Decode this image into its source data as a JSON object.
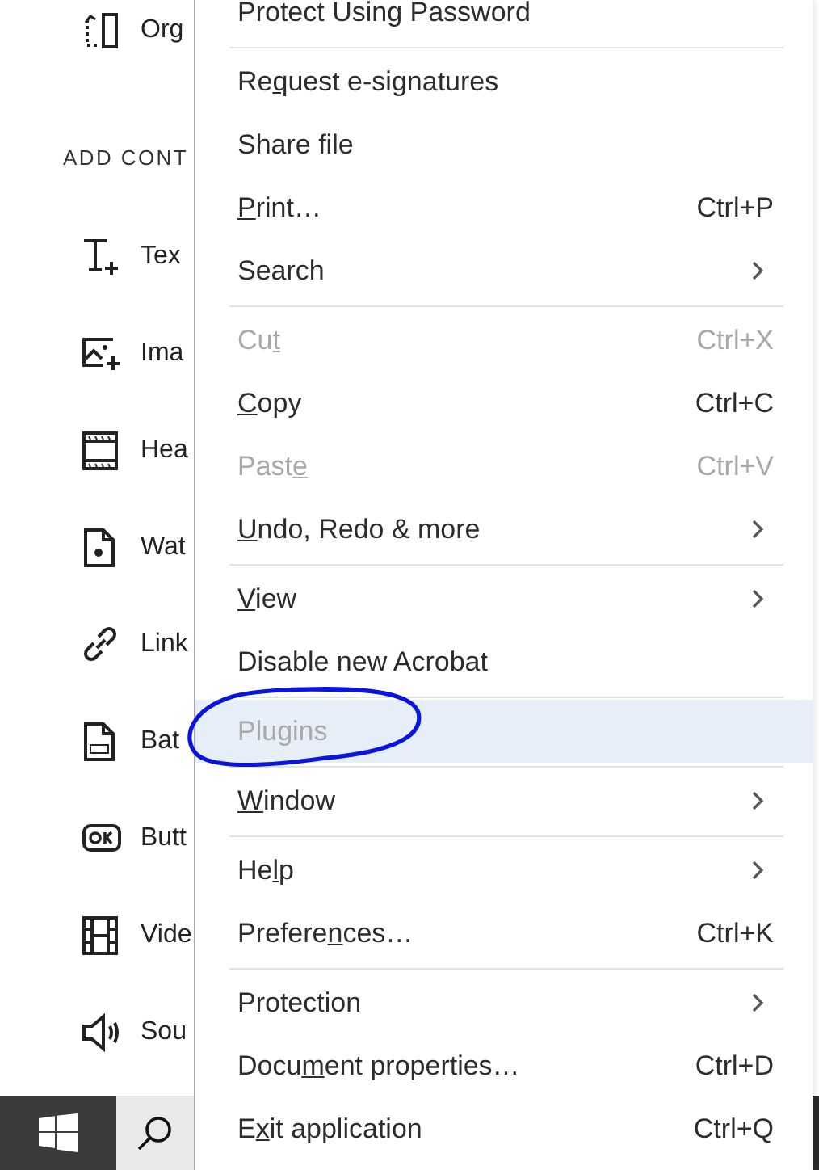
{
  "sidebar": {
    "items_top": [
      {
        "label": "Org"
      }
    ],
    "section_header": "ADD CONT",
    "items": [
      {
        "label": "Tex"
      },
      {
        "label": "Ima"
      },
      {
        "label": "Hea"
      },
      {
        "label": "Wat"
      },
      {
        "label": "Link"
      },
      {
        "label": "Bat"
      },
      {
        "label": "Butt"
      },
      {
        "label": "Vide"
      },
      {
        "label": "Sou"
      }
    ]
  },
  "context_menu": {
    "entries": [
      {
        "kind": "item",
        "label": "Protect Using Password",
        "submenu": false,
        "disabled": false,
        "hovered": false
      },
      {
        "kind": "separator"
      },
      {
        "kind": "item",
        "label_start": "Re",
        "mnemonic": "q",
        "label_end": "uest e-signatures",
        "submenu": false,
        "disabled": false,
        "hovered": false
      },
      {
        "kind": "item",
        "label": "Share file",
        "submenu": false,
        "disabled": false,
        "hovered": false
      },
      {
        "kind": "item",
        "mnemonic": "P",
        "label_end": "rint…",
        "shortcut": "Ctrl+P",
        "submenu": false,
        "disabled": false,
        "hovered": false
      },
      {
        "kind": "item",
        "label": "Search",
        "submenu": true,
        "disabled": false,
        "hovered": false
      },
      {
        "kind": "separator"
      },
      {
        "kind": "item",
        "label_start": "Cu",
        "mnemonic": "t",
        "shortcut": "Ctrl+X",
        "submenu": false,
        "disabled": true,
        "hovered": false
      },
      {
        "kind": "item",
        "mnemonic": "C",
        "label_end": "opy",
        "shortcut": "Ctrl+C",
        "submenu": false,
        "disabled": false,
        "hovered": false
      },
      {
        "kind": "item",
        "label_start": "Past",
        "mnemonic": "e",
        "shortcut": "Ctrl+V",
        "submenu": false,
        "disabled": true,
        "hovered": false
      },
      {
        "kind": "item",
        "mnemonic": "U",
        "label_end": "ndo, Redo & more",
        "submenu": true,
        "disabled": false,
        "hovered": false
      },
      {
        "kind": "separator"
      },
      {
        "kind": "item",
        "mnemonic": "V",
        "label_end": "iew",
        "submenu": true,
        "disabled": false,
        "hovered": false
      },
      {
        "kind": "item",
        "label": "Disable new Acrobat",
        "submenu": false,
        "disabled": false,
        "hovered": false
      },
      {
        "kind": "separator"
      },
      {
        "kind": "item",
        "label": "Plugins",
        "submenu": false,
        "disabled": true,
        "hovered": true
      },
      {
        "kind": "separator"
      },
      {
        "kind": "item",
        "mnemonic": "W",
        "label_end": "indow",
        "submenu": true,
        "disabled": false,
        "hovered": false
      },
      {
        "kind": "separator"
      },
      {
        "kind": "item",
        "label_start": "He",
        "mnemonic": "l",
        "label_end": "p",
        "submenu": true,
        "disabled": false,
        "hovered": false
      },
      {
        "kind": "item",
        "label_start": "Prefere",
        "mnemonic": "n",
        "label_end": "ces…",
        "shortcut": "Ctrl+K",
        "submenu": false,
        "disabled": false,
        "hovered": false
      },
      {
        "kind": "separator"
      },
      {
        "kind": "item",
        "label": "Protection",
        "submenu": true,
        "disabled": false,
        "hovered": false
      },
      {
        "kind": "item",
        "label_start": "Docu",
        "mnemonic": "m",
        "label_end": "ent properties…",
        "shortcut": "Ctrl+D",
        "submenu": false,
        "disabled": false,
        "hovered": false
      },
      {
        "kind": "item",
        "label_start": "E",
        "mnemonic": "x",
        "label_end": "it application",
        "shortcut": "Ctrl+Q",
        "submenu": false,
        "disabled": false,
        "hovered": false
      }
    ]
  },
  "annotation": {
    "kind": "ellipse"
  },
  "taskbar": {
    "start": true,
    "search": true
  }
}
